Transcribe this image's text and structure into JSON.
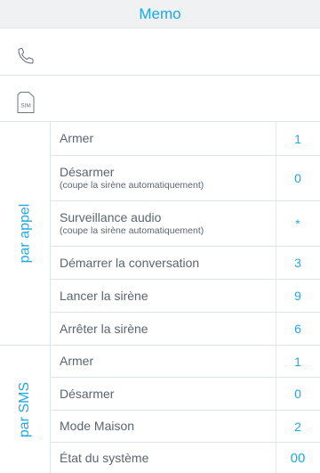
{
  "header": {
    "title": "Memo"
  },
  "fields": {
    "phone_icon": "phone-icon",
    "sim_icon": "sim-card-icon",
    "sim_label": "SIM"
  },
  "sections": {
    "call": {
      "label": "par appel",
      "commands": [
        {
          "label": "Armer",
          "note": "",
          "code": "1"
        },
        {
          "label": "Désarmer",
          "note": "(coupe la sirène automatiquement)",
          "code": "0"
        },
        {
          "label": "Surveillance audio",
          "note": "(coupe la sirène automatiquement)",
          "code": "*"
        },
        {
          "label": "Démarrer la conversation",
          "note": "",
          "code": "3"
        },
        {
          "label": "Lancer la sirène",
          "note": "",
          "code": "9"
        },
        {
          "label": "Arrêter la sirène",
          "note": "",
          "code": "6"
        }
      ]
    },
    "sms": {
      "label": "par SMS",
      "commands": [
        {
          "label": "Armer",
          "note": "",
          "code": "1"
        },
        {
          "label": "Désarmer",
          "note": "",
          "code": "0"
        },
        {
          "label": "Mode Maison",
          "note": "",
          "code": "2"
        },
        {
          "label": "État du système",
          "note": "",
          "code": "00"
        }
      ]
    }
  },
  "colors": {
    "accent": "#1fa8e6",
    "text": "#5a6570",
    "header_bg": "#eff1f3",
    "divider": "#dfe4ea"
  }
}
